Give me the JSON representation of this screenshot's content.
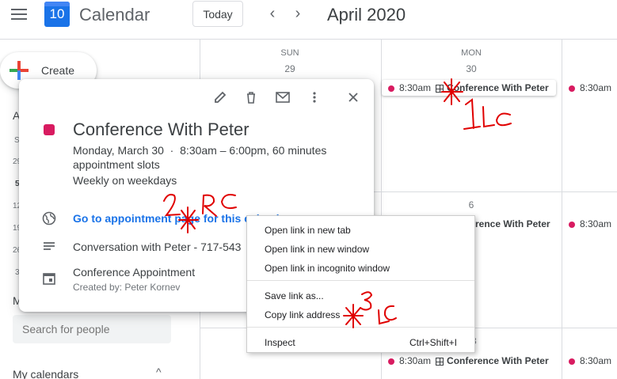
{
  "header": {
    "app_name": "Calendar",
    "logo_day": "10",
    "today_label": "Today",
    "month_label": "April 2020"
  },
  "sidebar": {
    "create_label": "Create",
    "partial_letters": [
      "A",
      "S",
      "29",
      "5",
      "12",
      "19",
      "26",
      "3"
    ],
    "m_label": "M",
    "search_placeholder": "Search for people",
    "my_calendars_label": "My calendars"
  },
  "grid": {
    "days": [
      {
        "name": "SUN",
        "num": "29"
      },
      {
        "name": "MON",
        "num": "30"
      }
    ],
    "week2_mon_num": "6",
    "week3_mon_num": "13"
  },
  "events": {
    "time": "8:30am",
    "title": "Conference With Peter",
    "partial_time": "8:30am"
  },
  "popup": {
    "title": "Conference With Peter",
    "date_line": "Monday, March 30",
    "time_line": "8:30am – 6:00pm, 60 minutes",
    "slots_line": "appointment slots",
    "repeat_line": "Weekly on weekdays",
    "link_text": "Go to appointment page for this calendar",
    "description": "Conversation with Peter - 717-543",
    "calendar_name": "Conference Appointment",
    "created_by": "Created by: Peter Kornev"
  },
  "context_menu": {
    "items": [
      "Open link in new tab",
      "Open link in new window",
      "Open link in incognito window",
      "Save link as...",
      "Copy link address",
      "Inspect"
    ],
    "inspect_shortcut": "Ctrl+Shift+I"
  },
  "annotations": {
    "step1": "1 LC",
    "step2": "2 RC",
    "step3": "3 LC",
    "color": "#e00000"
  }
}
